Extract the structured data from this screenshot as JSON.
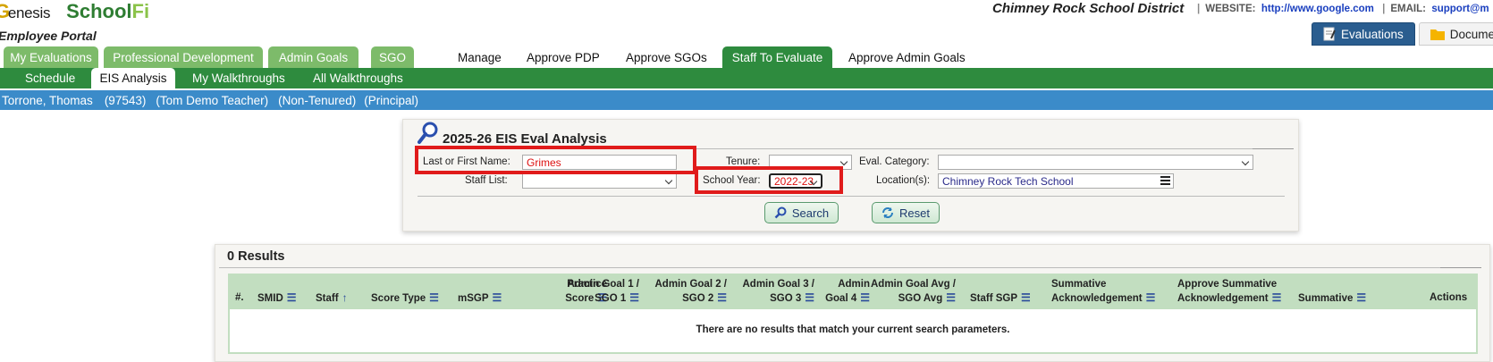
{
  "header": {
    "logo_genesis": "enesis",
    "logo_school": "School",
    "logo_fi": "Fi",
    "portal": "Employee Portal",
    "district": "Chimney Rock School District",
    "website_label": "WEBSITE:",
    "website_url": "http://www.google.com",
    "email_label": "EMAIL:",
    "email_value": "support@m",
    "evaluations_button": "Evaluations",
    "documents_button": "Documen"
  },
  "nav1": {
    "tabs": [
      "My Evaluations",
      "Professional Development",
      "Admin Goals",
      "SGO"
    ],
    "links": [
      "Manage",
      "Approve PDP",
      "Approve SGOs",
      "Staff To Evaluate",
      "Approve Admin Goals"
    ]
  },
  "nav2": {
    "items": [
      "Schedule",
      "EIS Analysis",
      "My Walkthroughs",
      "All Walkthroughs"
    ]
  },
  "user": {
    "name": "Torrone, Thomas",
    "id": "(97543)",
    "title": "(Tom Demo Teacher)",
    "tenure": "(Non-Tenured)",
    "role": "(Principal)"
  },
  "search": {
    "title": "2025-26 EIS Eval Analysis",
    "name_label": "Last or First Name:",
    "name_value": "Grimes",
    "tenure_label": "Tenure:",
    "tenure_value": "",
    "category_label": "Eval. Category:",
    "category_value": "",
    "staff_list_label": "Staff List:",
    "staff_list_value": "",
    "school_year_label": "School Year:",
    "school_year_value": "2022-23",
    "location_label": "Location(s):",
    "location_value": "Chimney Rock Tech School",
    "search_button": "Search",
    "reset_button": "Reset"
  },
  "results": {
    "count": "0 Results",
    "columns": {
      "num": "#.",
      "smid": "SMID",
      "staff": "Staff",
      "score_type": "Score Type",
      "msgp": "mSGP",
      "practice_1": "Practice",
      "practice_2": "Score",
      "ag1_1": "Admin Goal 1 /",
      "ag1_2": "SGO 1",
      "ag2_1": "Admin Goal 2 /",
      "ag2_2": "SGO 2",
      "ag3_1": "Admin Goal 3 /",
      "ag3_2": "SGO 3",
      "ag4_1": "Admin",
      "ag4_2": "Goal 4",
      "agavg_1": "Admin Goal Avg /",
      "agavg_2": "SGO Avg",
      "staff_sgp": "Staff SGP",
      "summ_ack_1": "Summative",
      "summ_ack_2": "Acknowledgement",
      "appr_ack_1": "Approve Summative",
      "appr_ack_2": "Acknowledgement",
      "summative": "Summative",
      "actions": "Actions"
    },
    "empty_message": "There are no results that match your current search parameters."
  }
}
